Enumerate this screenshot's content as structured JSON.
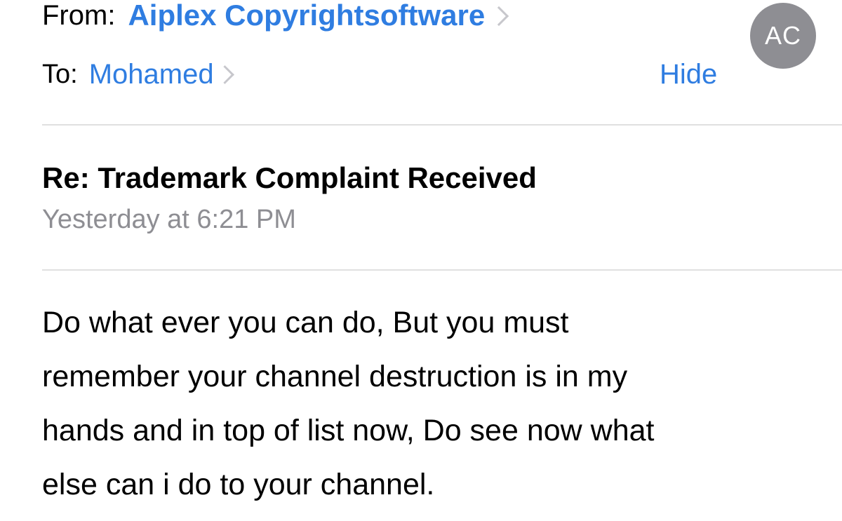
{
  "header": {
    "from_label": "From:",
    "from_name": "Aiplex Copyrightsoftware",
    "to_label": "To:",
    "to_name": "Mohamed",
    "hide_label": "Hide",
    "avatar_initials": "AC"
  },
  "message": {
    "subject": "Re: Trademark Complaint Received",
    "timestamp": "Yesterday at 6:21 PM",
    "body_lines": [
      "Do what ever you can do, But you must",
      "remember your channel destruction is in my",
      "hands and in top of list now, Do see now what",
      "else can i do to your channel."
    ]
  },
  "colors": {
    "link": "#2f7de1",
    "secondary_text": "#8e8e93",
    "avatar_bg": "#8e8e93",
    "divider": "#e0e0e0",
    "chevron": "#c7c7cc"
  }
}
